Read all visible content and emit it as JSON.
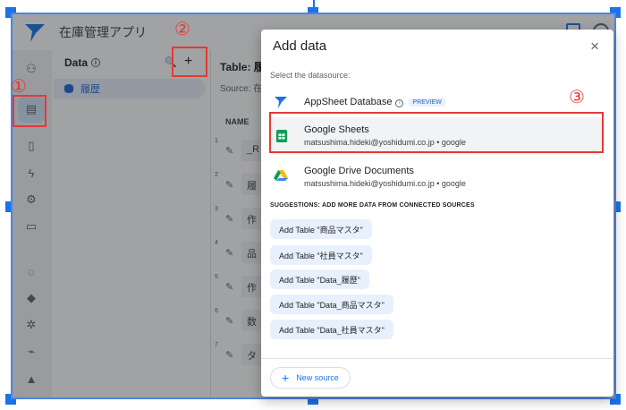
{
  "app": {
    "title": "在庫管理アプリ"
  },
  "data_panel": {
    "header": "Data",
    "table_item": "履歴"
  },
  "table_panel": {
    "title": "Table: 履歴",
    "source": "Source: 在",
    "column_header": "NAME",
    "rows": [
      {
        "num": "1",
        "cell": "_R"
      },
      {
        "num": "2",
        "cell": "履"
      },
      {
        "num": "3",
        "cell": "作"
      },
      {
        "num": "4",
        "cell": "品"
      },
      {
        "num": "5",
        "cell": "作"
      },
      {
        "num": "6",
        "cell": "数"
      },
      {
        "num": "7",
        "cell": "タ"
      }
    ]
  },
  "modal": {
    "title": "Add data",
    "close": "×",
    "select_label": "Select the datasource:",
    "datasources": [
      {
        "name": "AppSheet Database",
        "badge": "PREVIEW",
        "sub": ""
      },
      {
        "name": "Google Sheets",
        "sub": "matsushima.hideki@yoshidumi.co.jp • google"
      },
      {
        "name": "Google Drive Documents",
        "sub": "matsushima.hideki@yoshidumi.co.jp • google"
      }
    ],
    "suggestions_label": "SUGGESTIONS: ADD MORE DATA FROM CONNECTED SOURCES",
    "suggestions": [
      "Add Table \"商品マスタ\"",
      "Add Table \"社員マスタ\"",
      "Add Table \"Data_履歴\"",
      "Add Table \"Data_商品マスタ\"",
      "Add Table \"Data_社員マスタ\""
    ],
    "new_source": "New source"
  },
  "annotations": {
    "one": "①",
    "two": "②",
    "three": "③"
  },
  "colors": {
    "accent": "#1a73e8",
    "annotation": "#e53935",
    "sheets_green": "#0f9d58"
  }
}
